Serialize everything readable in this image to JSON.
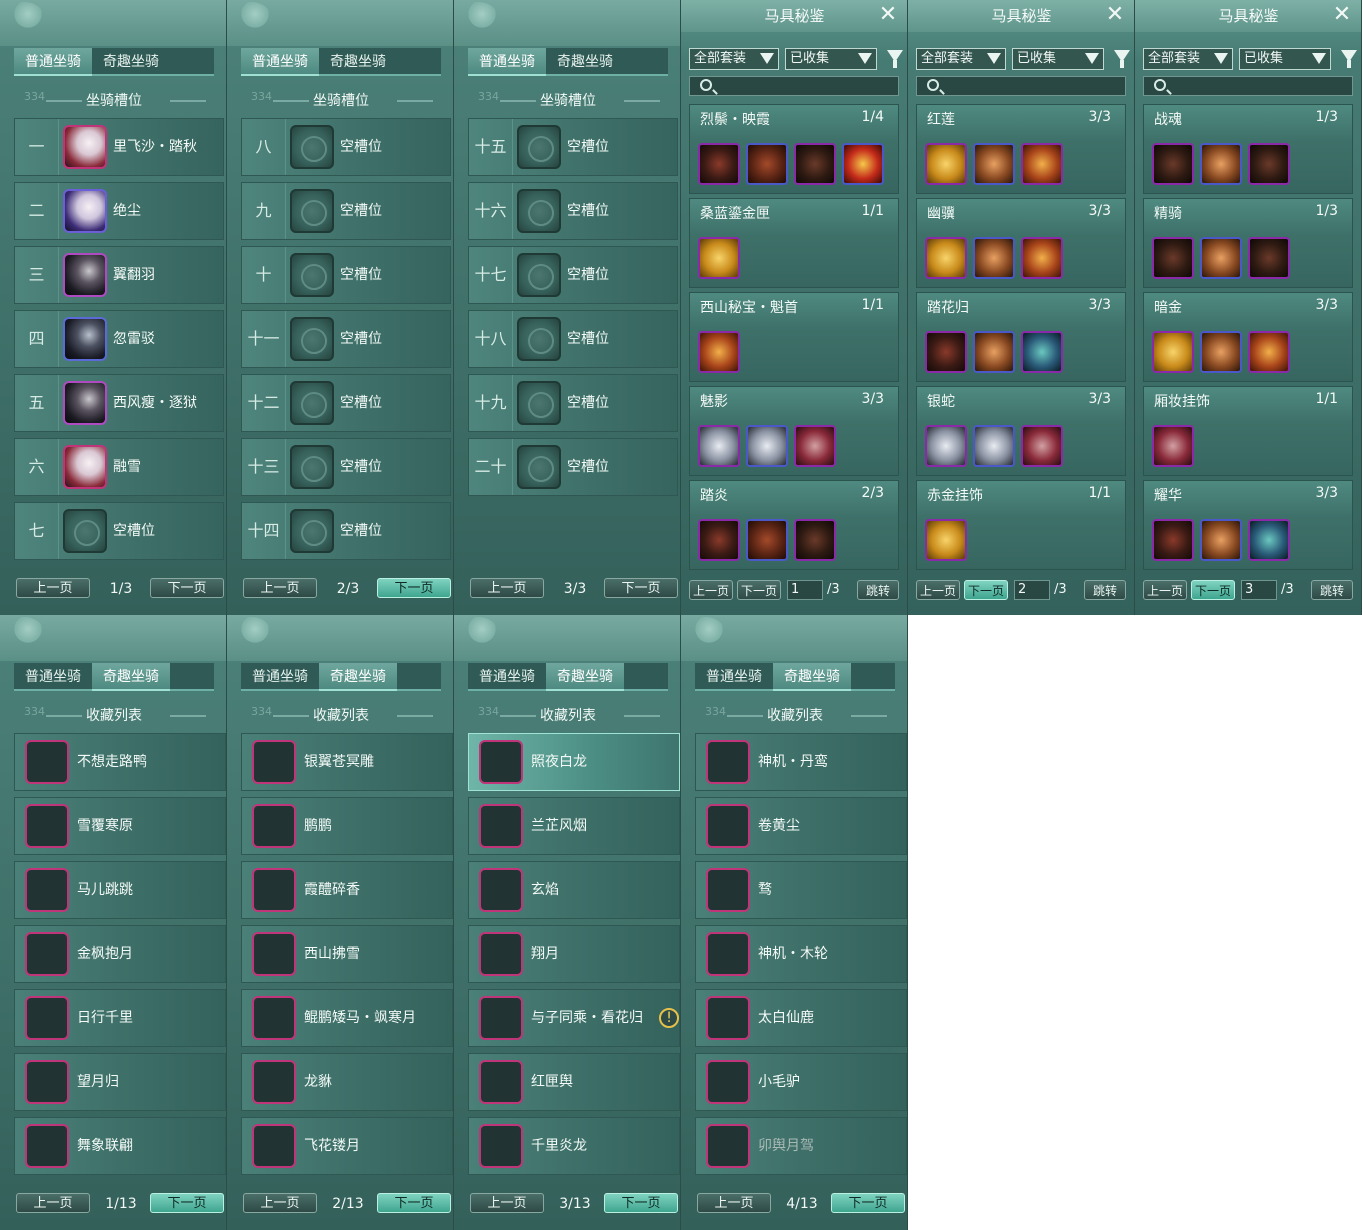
{
  "accent": "#6fb0a6",
  "highlight": "#7fd3c0",
  "tabs": [
    "普通坐骑",
    "奇趣坐骑"
  ],
  "slot_title": "坐骑槽位",
  "collection_title": "收藏列表",
  "watermark": "334",
  "prev_label": "上一页",
  "next_label": "下一页",
  "slot_pages": [
    {
      "page": "1/3",
      "slots": [
        {
          "num": "一",
          "name": "里飞沙・踏秋",
          "icon": "h-white"
        },
        {
          "num": "二",
          "name": "绝尘",
          "icon": "h-blue"
        },
        {
          "num": "三",
          "name": "翼翻羽",
          "icon": "h-dark"
        },
        {
          "num": "四",
          "name": "忽雷驳",
          "icon": "h-dark2"
        },
        {
          "num": "五",
          "name": "西风瘦・逐狱",
          "icon": "h-dark"
        },
        {
          "num": "六",
          "name": "融雪",
          "icon": "h-white"
        },
        {
          "num": "七",
          "name": "空槽位",
          "icon": "empty"
        }
      ]
    },
    {
      "page": "2/3",
      "slots": [
        {
          "num": "八",
          "name": "空槽位",
          "icon": "empty"
        },
        {
          "num": "九",
          "name": "空槽位",
          "icon": "empty"
        },
        {
          "num": "十",
          "name": "空槽位",
          "icon": "empty"
        },
        {
          "num": "十一",
          "name": "空槽位",
          "icon": "empty"
        },
        {
          "num": "十二",
          "name": "空槽位",
          "icon": "empty"
        },
        {
          "num": "十三",
          "name": "空槽位",
          "icon": "empty"
        },
        {
          "num": "十四",
          "name": "空槽位",
          "icon": "empty"
        }
      ]
    },
    {
      "page": "3/3",
      "slots": [
        {
          "num": "十五",
          "name": "空槽位",
          "icon": "empty"
        },
        {
          "num": "十六",
          "name": "空槽位",
          "icon": "empty"
        },
        {
          "num": "十七",
          "name": "空槽位",
          "icon": "empty"
        },
        {
          "num": "十八",
          "name": "空槽位",
          "icon": "empty"
        },
        {
          "num": "十九",
          "name": "空槽位",
          "icon": "empty"
        },
        {
          "num": "二十",
          "name": "空槽位",
          "icon": "empty"
        }
      ]
    }
  ],
  "set_window": {
    "title": "马具秘鉴",
    "filter_all": "全部套装",
    "filter_collected": "已收集",
    "jump_label": "跳转",
    "pages": [
      {
        "page_input": "1",
        "total": "/3",
        "sets": [
          {
            "name": "烈鬃・映霞",
            "count": "1/4",
            "items": [
              "g1",
              "g2",
              "g3",
              "g4"
            ]
          },
          {
            "name": "桑蓝鎏金匣",
            "count": "1/1",
            "items": [
              "g5"
            ]
          },
          {
            "name": "西山秘宝・魁首",
            "count": "1/1",
            "items": [
              "g6"
            ]
          },
          {
            "name": "魅影",
            "count": "3/3",
            "items": [
              "g7",
              "g7",
              "g8"
            ]
          },
          {
            "name": "踏炎",
            "count": "2/3",
            "items": [
              "g1",
              "g2",
              "g3"
            ]
          }
        ]
      },
      {
        "page_input": "2",
        "total": "/3",
        "sets": [
          {
            "name": "红莲",
            "count": "3/3",
            "items": [
              "g5",
              "g9",
              "g6"
            ]
          },
          {
            "name": "幽骥",
            "count": "3/3",
            "items": [
              "g5",
              "g9",
              "g6"
            ]
          },
          {
            "name": "踏花归",
            "count": "3/3",
            "items": [
              "g1",
              "g9",
              "g10"
            ]
          },
          {
            "name": "银蛇",
            "count": "3/3",
            "items": [
              "g7",
              "g7",
              "g8"
            ]
          },
          {
            "name": "赤金挂饰",
            "count": "1/1",
            "items": [
              "g5"
            ]
          }
        ]
      },
      {
        "page_input": "3",
        "total": "/3",
        "sets": [
          {
            "name": "战魂",
            "count": "1/3",
            "items": [
              "g3",
              "g9",
              "g3"
            ]
          },
          {
            "name": "精骑",
            "count": "1/3",
            "items": [
              "g3",
              "g9",
              "g3"
            ]
          },
          {
            "name": "暗金",
            "count": "3/3",
            "items": [
              "g5",
              "g9",
              "g6"
            ]
          },
          {
            "name": "厢妆挂饰",
            "count": "1/1",
            "items": [
              "g8"
            ]
          },
          {
            "name": "耀华",
            "count": "3/3",
            "items": [
              "g1",
              "g9",
              "g10"
            ]
          }
        ]
      }
    ]
  },
  "collection_pages": [
    {
      "page": "1/13",
      "items": [
        {
          "name": "不想走路鸭",
          "icon": "c1"
        },
        {
          "name": "雪覆寒原",
          "icon": "c2"
        },
        {
          "name": "马儿跳跳",
          "icon": "c3"
        },
        {
          "name": "金枫抱月",
          "icon": "c4"
        },
        {
          "name": "日行千里",
          "icon": "c5"
        },
        {
          "name": "望月归",
          "icon": "c6"
        },
        {
          "name": "舞象联翩",
          "icon": "c7"
        }
      ]
    },
    {
      "page": "2/13",
      "items": [
        {
          "name": "银翼苍冥雕",
          "icon": "c8"
        },
        {
          "name": "鹏鹏",
          "icon": "c9"
        },
        {
          "name": "霞醴碎香",
          "icon": "c10"
        },
        {
          "name": "西山拂雪",
          "icon": "c11"
        },
        {
          "name": "鲲鹏矮马・飒寒月",
          "icon": "c12"
        },
        {
          "name": "龙貅",
          "icon": "c13"
        },
        {
          "name": "飞花镂月",
          "icon": "c14"
        }
      ]
    },
    {
      "page": "3/13",
      "items": [
        {
          "name": "照夜白龙",
          "icon": "c11"
        },
        {
          "name": "兰芷风烟",
          "icon": "c15"
        },
        {
          "name": "玄焰",
          "icon": "c15"
        },
        {
          "name": "翔月",
          "icon": "c2"
        },
        {
          "name": "与子同乘・看花归",
          "icon": "c16",
          "warn": "!"
        },
        {
          "name": "红匣舆",
          "icon": "c17"
        },
        {
          "name": "千里炎龙",
          "icon": "c17"
        }
      ]
    },
    {
      "page": "4/13",
      "items": [
        {
          "name": "神机・丹鸾",
          "icon": "c18"
        },
        {
          "name": "卷黄尘",
          "icon": "c19"
        },
        {
          "name": "骛",
          "icon": "c9"
        },
        {
          "name": "神机・木轮",
          "icon": "c5"
        },
        {
          "name": "太白仙鹿",
          "icon": "c11"
        },
        {
          "name": "小毛驴",
          "icon": "c15"
        },
        {
          "name": "卯舆月驾",
          "icon": "c20",
          "dim": true
        }
      ]
    }
  ]
}
